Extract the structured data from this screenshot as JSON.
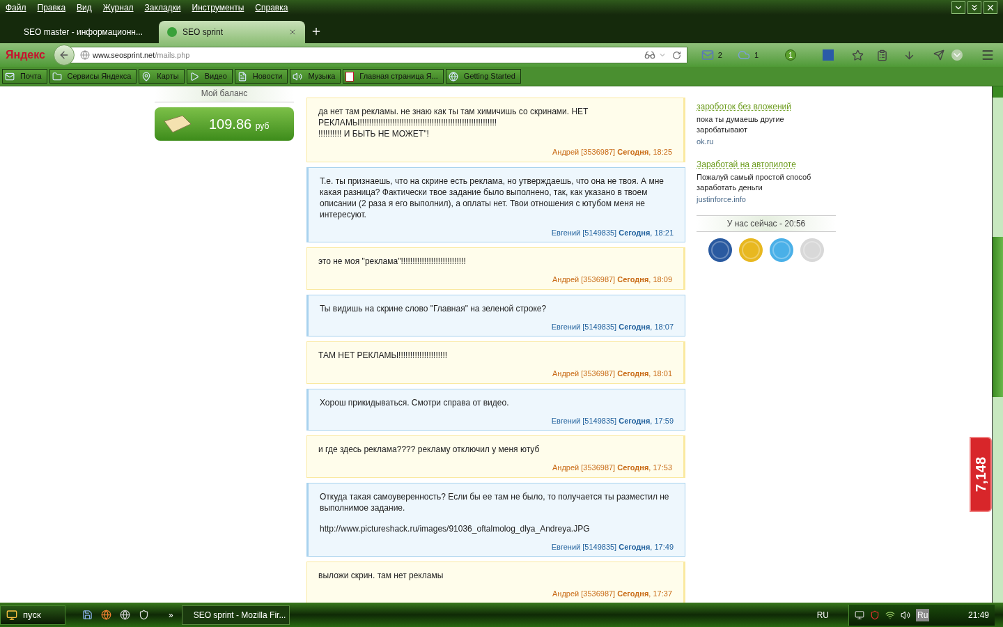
{
  "menu": [
    "Файл",
    "Правка",
    "Вид",
    "Журнал",
    "Закладки",
    "Инструменты",
    "Справка"
  ],
  "tabs": [
    {
      "label": "SEO master - информационн...",
      "selected": false
    },
    {
      "label": "SEO sprint",
      "selected": true
    }
  ],
  "nav": {
    "logo": "Яндекс",
    "url_host": "www.seosprint.net",
    "url_path": "/mails.php",
    "mail_count": "2",
    "cloud_count": "1",
    "badge": "1"
  },
  "bookmarks": [
    "Почта",
    "Сервисы Яндекса",
    "Карты",
    "Видео",
    "Новости",
    "Музыка",
    "Главная страница Я...",
    "Getting Started"
  ],
  "balance": {
    "title": "Мой баланс",
    "amount": "109.86",
    "currency": "руб"
  },
  "messages": [
    {
      "kind": "in",
      "text": "да нет там рекламы. не знаю как ты там химичишь со скринами. НЕТ РЕКЛАМЫ!!!!!!!!!!!!!!!!!!!!!!!!!!!!!!!!!!!!!!!!!!!!!!!!!!!!!!!!!!!\n!!!!!!!!!! И БЫТЬ НЕ МОЖЕТ\"!",
      "meta": "Андрей [3536987] **Сегодня**, 18:25"
    },
    {
      "kind": "out",
      "text": "Т.е. ты признаешь, что на скрине есть реклама, но утверждаешь, что она не твоя. А мне какая разница? Фактически твое задание было выполнено, так, как указано в твоем описании (2 раза я его выполнил), а оплаты нет. Твои отношения с ютубом меня не интересуют.",
      "meta": "Евгений [5149835] **Сегодня**, 18:21"
    },
    {
      "kind": "in",
      "text": "это не моя \"реклама\"!!!!!!!!!!!!!!!!!!!!!!!!!!!!",
      "meta": "Андрей [3536987] **Сегодня**, 18:09"
    },
    {
      "kind": "out",
      "text": "Ты видишь на скрине слово \"Главная\" на зеленой строке?",
      "meta": "Евгений [5149835] **Сегодня**, 18:07"
    },
    {
      "kind": "in",
      "text": "ТАМ НЕТ РЕКЛАМЫ!!!!!!!!!!!!!!!!!!!!!",
      "meta": "Андрей [3536987] **Сегодня**, 18:01"
    },
    {
      "kind": "out",
      "text": "Хорош прикидываться. Смотри справа от видео.",
      "meta": "Евгений [5149835] **Сегодня**, 17:59"
    },
    {
      "kind": "in",
      "text": "и где здесь реклама???? рекламу отключил у меня ютуб",
      "meta": "Андрей [3536987] **Сегодня**, 17:53"
    },
    {
      "kind": "out",
      "text": "Откуда такая самоуверенность? Если бы ее там не было, то получается ты разместил не выполнимое задание.",
      "link": "http://www.pictureshack.ru/images/91036_oftalmolog_dlya_Andreya.JPG",
      "meta": "Евгений [5149835] **Сегодня**, 17:49"
    },
    {
      "kind": "in",
      "text": "выложи скрин. там нет рекламы",
      "meta": "Андрей [3536987] **Сегодня**, 17:37"
    }
  ],
  "ads": [
    {
      "title": "зароботок без вложений",
      "text": "пока ты думаешь другие заробатывают",
      "site": "ok.ru"
    },
    {
      "title": "Заработай на автопилоте",
      "text": "Пожалуй самый простой способ заработать деньги",
      "site": "justinforce.info"
    }
  ],
  "clock": "У нас сейчас - 20:56",
  "counter": "7,148",
  "taskbar": {
    "start": "пуск",
    "more": "»",
    "task": "SEO sprint - Mozilla Fir...",
    "lang": "RU",
    "lang2": "Ru",
    "time": "21:49"
  }
}
